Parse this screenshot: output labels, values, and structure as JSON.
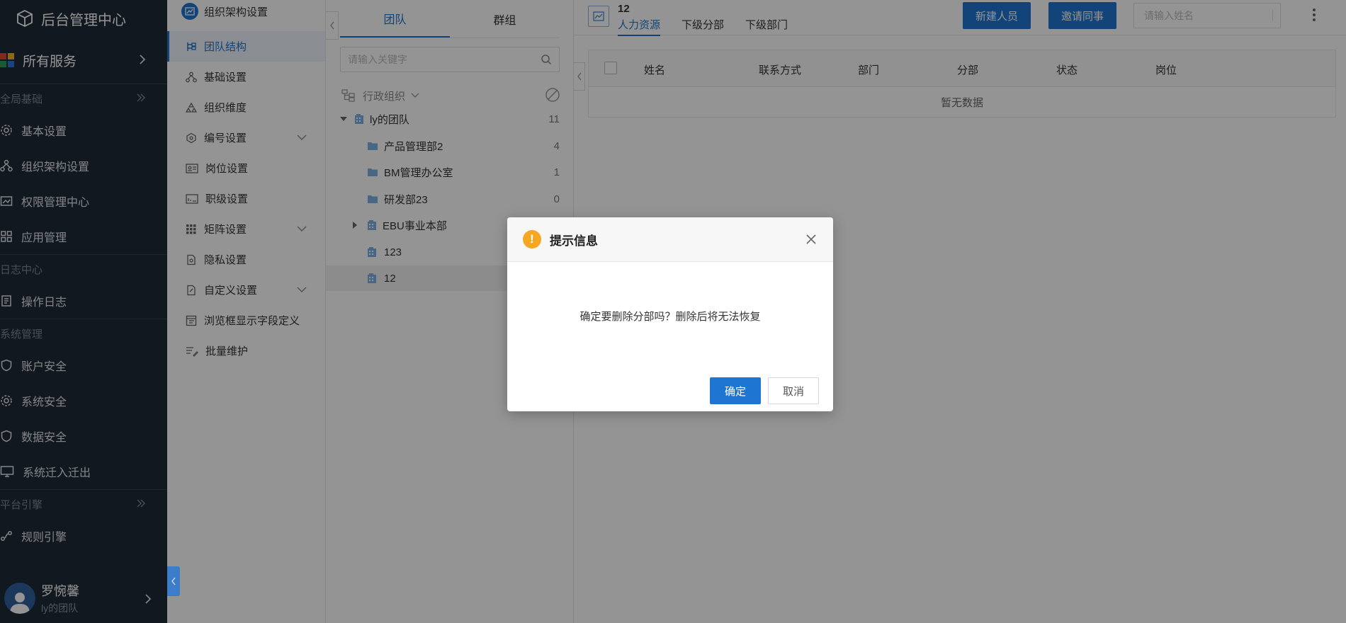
{
  "nav": {
    "brand": "后台管理中心",
    "all_services": "所有服务",
    "groups": [
      {
        "label": "全局基础"
      },
      {
        "label": "日志中心"
      },
      {
        "label": "系统管理"
      },
      {
        "label": "平台引擎"
      }
    ],
    "items": [
      {
        "label": "基本设置",
        "icon": "gear-icon"
      },
      {
        "label": "组织架构设置",
        "icon": "org-chart-icon"
      },
      {
        "label": "权限管理中心",
        "icon": "permission-icon"
      },
      {
        "label": "应用管理",
        "icon": "apps-grid-icon"
      },
      {
        "label": "操作日志",
        "icon": "log-icon"
      },
      {
        "label": "账户安全",
        "icon": "shield-icon"
      },
      {
        "label": "系统安全",
        "icon": "gear-icon"
      },
      {
        "label": "数据安全",
        "icon": "shield-icon"
      },
      {
        "label": "系统迁入迁出",
        "icon": "monitor-icon"
      },
      {
        "label": "规则引擎",
        "icon": "rule-engine-icon"
      }
    ],
    "user": {
      "name": "罗惋馨",
      "team": "ly的团队"
    }
  },
  "sub": {
    "header": "组织架构设置",
    "items": [
      {
        "label": "团队结构",
        "active": true
      },
      {
        "label": "基础设置"
      },
      {
        "label": "组织维度"
      },
      {
        "label": "编号设置",
        "expandable": true
      },
      {
        "label": "岗位设置"
      },
      {
        "label": "职级设置"
      },
      {
        "label": "矩阵设置",
        "expandable": true
      },
      {
        "label": "隐私设置"
      },
      {
        "label": "自定义设置",
        "expandable": true
      },
      {
        "label": "浏览框显示字段定义"
      },
      {
        "label": "批量维护"
      }
    ]
  },
  "tree": {
    "tabs": [
      "团队",
      "群组"
    ],
    "search_placeholder": "请输入关键字",
    "filter_label": "行政组织",
    "root": {
      "label": "ly的团队",
      "count": "11"
    },
    "nodes": [
      {
        "label": "产品管理部2",
        "count": "4"
      },
      {
        "label": "BM管理办公室",
        "count": "1"
      },
      {
        "label": "研发部23",
        "count": "0"
      },
      {
        "label": "EBU事业本部",
        "count": ""
      },
      {
        "label": "123",
        "count": ""
      },
      {
        "label": "12",
        "count": ""
      }
    ]
  },
  "main": {
    "dept_name": "12",
    "dept_tabs": [
      "人力资源",
      "下级分部",
      "下级部门"
    ],
    "new_person": "新建人员",
    "invite": "邀请同事",
    "search_placeholder": "请输入姓名",
    "columns": [
      "姓名",
      "联系方式",
      "部门",
      "分部",
      "状态",
      "岗位"
    ],
    "empty": "暂无数据"
  },
  "dialog": {
    "title": "提示信息",
    "message": "确定要删除分部吗？删除后将无法恢复",
    "ok": "确定",
    "cancel": "取消"
  },
  "colors": {
    "accent": "#1f76d2",
    "nav_bg": "#1f2a36",
    "warning": "#f5a623"
  }
}
